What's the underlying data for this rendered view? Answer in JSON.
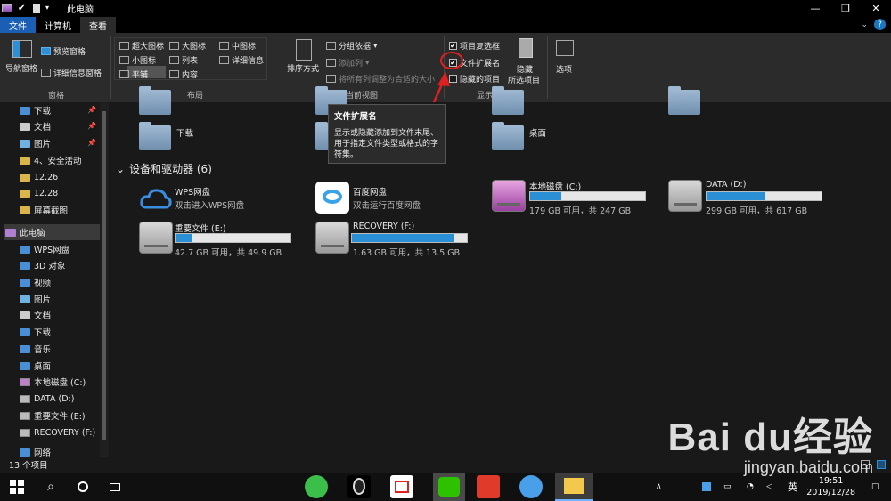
{
  "window": {
    "title": "此电脑"
  },
  "ribbon": {
    "tabs": [
      "文件",
      "计算机",
      "查看"
    ],
    "pane": {
      "nav": "导航窗格",
      "preview": "预览窗格",
      "details": "详细信息窗格",
      "label": "窗格"
    },
    "layout": {
      "items": [
        "超大图标",
        "大图标",
        "中图标",
        "小图标",
        "列表",
        "详细信息",
        "平铺",
        "内容"
      ],
      "label": "布局"
    },
    "current_view": {
      "sort": "排序方式",
      "group": "分组依据",
      "add_col": "添加列",
      "fit_cols": "将所有列调整为合适的大小",
      "label": "当前视图"
    },
    "show_hide": {
      "item_checkbox": "项目复选框",
      "file_ext": "文件扩展名",
      "hidden_items": "隐藏的项目",
      "hide_btn": "隐藏",
      "hide_sel": "所选项目",
      "label": "显示/隐藏"
    },
    "options": "选项"
  },
  "nav": {
    "items": [
      "下载",
      "文档",
      "图片",
      "4、安全活动",
      "12.26",
      "12.28",
      "屏幕截图",
      "此电脑",
      "WPS网盘",
      "3D 对象",
      "视频",
      "图片",
      "文档",
      "下载",
      "音乐",
      "桌面",
      "本地磁盘 (C:)",
      "DATA (D:)",
      "重要文件 (E:)",
      "RECOVERY (F:)",
      "网络"
    ]
  },
  "content": {
    "folders": [
      "下载",
      "桌面"
    ],
    "section": "设备和驱动器 (6)",
    "devices": [
      {
        "name": "WPS网盘",
        "sub": "双击进入WPS网盘"
      },
      {
        "name": "百度网盘",
        "sub": "双击运行百度网盘"
      },
      {
        "name": "本地磁盘 (C:)",
        "sub": "179 GB 可用，共 247 GB",
        "fill": 0.275
      },
      {
        "name": "DATA (D:)",
        "sub": "299 GB 可用，共 617 GB",
        "fill": 0.515
      },
      {
        "name": "重要文件 (E:)",
        "sub": "42.7 GB 可用，共 49.9 GB",
        "fill": 0.145
      },
      {
        "name": "RECOVERY (F:)",
        "sub": "1.63 GB 可用，共 13.5 GB",
        "fill": 0.88
      }
    ]
  },
  "tooltip": {
    "title": "文件扩展名",
    "body": "显示或隐藏添加到文件末尾、用于指定文件类型或格式的字符集。"
  },
  "status": {
    "count": "13 个项目"
  },
  "taskbar": {
    "ime": "英",
    "time": "19:51",
    "date": "2019/12/28"
  },
  "watermark": {
    "brand": "Bai du经验",
    "url": "jingyan.baidu.com"
  }
}
